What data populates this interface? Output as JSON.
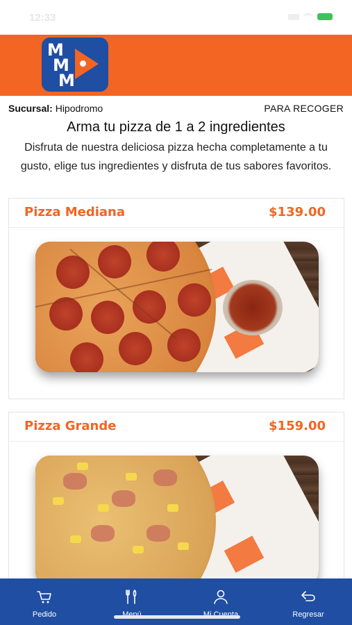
{
  "status_bar": {
    "time": "12:33"
  },
  "header": {
    "logo_letters": [
      "M",
      "M",
      "M"
    ],
    "brand_color": "#f26522",
    "logo_color": "#1f4ea3"
  },
  "info": {
    "branch_label": "Sucursal:",
    "branch_value": "Hipodromo",
    "mode": "PARA RECOGER"
  },
  "intro": {
    "title": "Arma tu pizza de 1 a 2 ingredientes",
    "description": "Disfruta de nuestra deliciosa pizza hecha completamente a tu gusto, elige tus ingredientes y disfruta de tus sabores favoritos."
  },
  "products": [
    {
      "name": "Pizza Mediana",
      "price": "$139.00"
    },
    {
      "name": "Pizza Grande",
      "price": "$159.00"
    }
  ],
  "nav": [
    {
      "label": "Pedido",
      "icon": "cart-icon"
    },
    {
      "label": "Menú",
      "icon": "utensils-icon"
    },
    {
      "label": "Mi Cuenta",
      "icon": "user-icon"
    },
    {
      "label": "Regresar",
      "icon": "back-arrow-icon"
    }
  ],
  "colors": {
    "accent": "#f26522",
    "nav_bg": "#1f4ea3"
  }
}
